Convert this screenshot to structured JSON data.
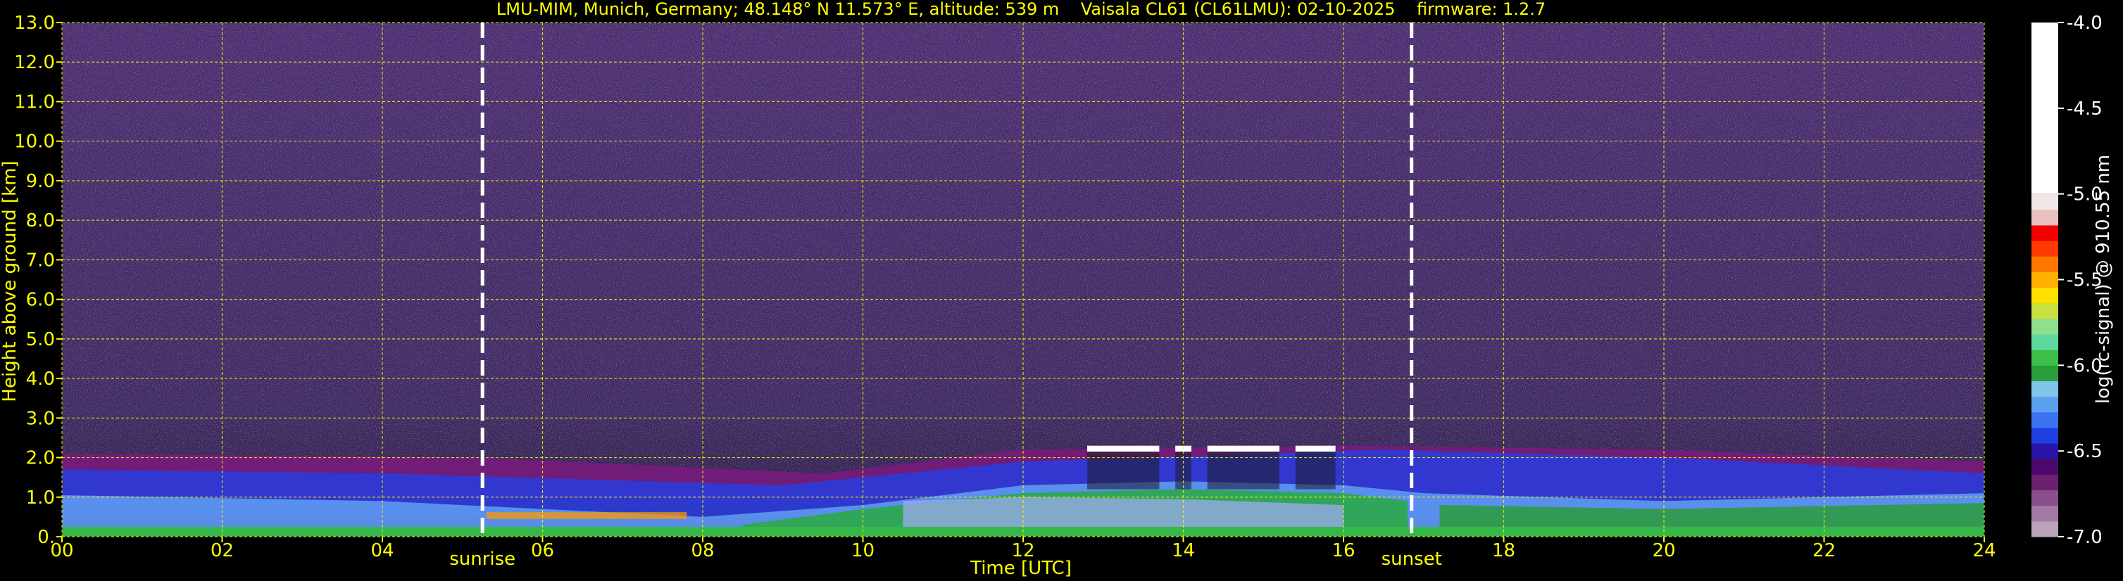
{
  "chart_data": {
    "type": "heatmap",
    "title": "LMU-MIM, Munich, Germany; 48.148° N 11.573° E, altitude: 539 m    Vaisala CL61 (CL61LMU): 02-10-2025    firmware: 1.2.7",
    "xlabel": "Time [UTC]",
    "ylabel": "Height above ground [km]",
    "xlim": [
      0,
      24
    ],
    "ylim": [
      0,
      13
    ],
    "x_ticks": [
      "00",
      "02",
      "04",
      "06",
      "08",
      "10",
      "12",
      "14",
      "16",
      "18",
      "20",
      "22",
      "24"
    ],
    "x_tick_values": [
      0,
      2,
      4,
      6,
      8,
      10,
      12,
      14,
      16,
      18,
      20,
      22,
      24
    ],
    "y_ticks": [
      "0.",
      "1.0",
      "2.0",
      "3.0",
      "4.0",
      "5.0",
      "6.0",
      "7.0",
      "8.0",
      "9.0",
      "10.0",
      "11.0",
      "12.0",
      "13.0"
    ],
    "y_tick_values": [
      0,
      1,
      2,
      3,
      4,
      5,
      6,
      7,
      8,
      9,
      10,
      11,
      12,
      13
    ],
    "grid": true,
    "colorbar": {
      "label": "log(rc-signal) @ 910.55 nm",
      "range": [
        -7.0,
        -4.0
      ],
      "ticks": [
        "-4.0",
        "-4.5",
        "-5.0",
        "-5.5",
        "-6.0",
        "-6.5",
        "-7.0"
      ],
      "tick_values": [
        -4.0,
        -4.5,
        -5.0,
        -5.5,
        -6.0,
        -6.5,
        -7.0
      ],
      "colors": [
        "#b9a3b8",
        "#a27aa3",
        "#8a4f8c",
        "#6d1f70",
        "#4b0a6b",
        "#2a14a8",
        "#1f3fe0",
        "#3a72f2",
        "#5aa0f0",
        "#7ec5e8",
        "#2a9e3a",
        "#3cc04a",
        "#5fd8a0",
        "#8fe08a",
        "#c8e040",
        "#ffe000",
        "#ffb000",
        "#ff7800",
        "#ff3a00",
        "#f00000",
        "#e8c0c0",
        "#f2e6e6",
        "#ffffff"
      ]
    },
    "events": [
      {
        "label": "sunrise",
        "x": 5.25
      },
      {
        "label": "sunset",
        "x": 16.85
      }
    ]
  }
}
